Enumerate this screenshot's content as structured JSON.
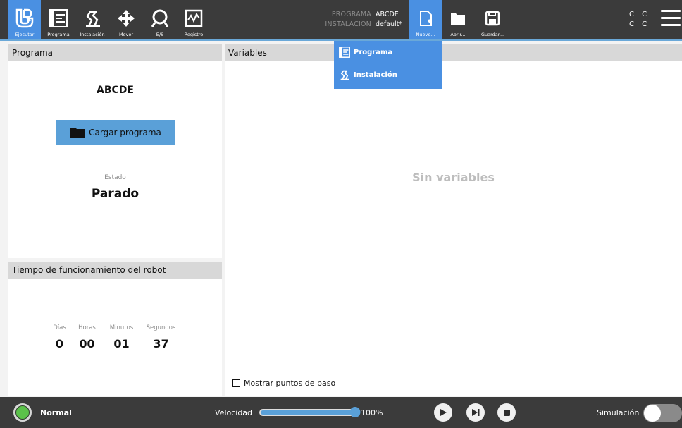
{
  "topbar": {
    "tabs": [
      {
        "label": "Ejecutar",
        "icon": "ur-logo-icon"
      },
      {
        "label": "Programa",
        "icon": "program-tree-icon"
      },
      {
        "label": "Instalación",
        "icon": "robot-arm-icon"
      },
      {
        "label": "Mover",
        "icon": "move-arrows-icon"
      },
      {
        "label": "E/S",
        "icon": "io-icon"
      },
      {
        "label": "Registro",
        "icon": "log-chart-icon"
      }
    ],
    "program_label": "PROGRAMA",
    "program_value": "ABCDE",
    "installation_label": "INSTALACIÓN",
    "installation_value": "default*",
    "file_buttons": [
      {
        "label": "Nuevo...",
        "icon": "new-file-icon"
      },
      {
        "label": "Abrir...",
        "icon": "folder-icon"
      },
      {
        "label": "Guardar...",
        "icon": "save-icon"
      }
    ],
    "cc_text": "C C\nC C"
  },
  "new_menu": {
    "items": [
      {
        "label": "Programa",
        "icon": "program-tree-icon"
      },
      {
        "label": "Instalación",
        "icon": "robot-arm-icon"
      }
    ]
  },
  "program_panel": {
    "title": "Programa",
    "program_name": "ABCDE",
    "load_button": "Cargar programa",
    "state_label": "Estado",
    "state_value": "Parado"
  },
  "runtime_panel": {
    "title": "Tiempo de funcionamiento del robot",
    "labels": [
      "Días",
      "Horas",
      "Minutos",
      "Segundos"
    ],
    "values": [
      "0",
      "00",
      "01",
      "37"
    ]
  },
  "variables_panel": {
    "title": "Variables",
    "empty_text": "Sin variables",
    "waypoints_label": "Mostrar puntos de paso",
    "waypoints_checked": false
  },
  "bottombar": {
    "status": "Normal",
    "status_color": "#5bc24a",
    "speed_label": "Velocidad",
    "speed_value": "100%",
    "speed_fraction": 1.0,
    "simulation_label": "Simulación",
    "simulation_on": false,
    "accent_color": "#5aa0d8"
  }
}
